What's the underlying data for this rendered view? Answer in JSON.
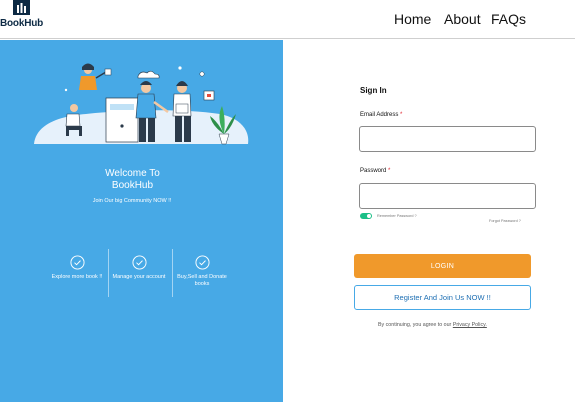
{
  "header": {
    "logo_text": "BookHub",
    "nav": {
      "home": "Home",
      "about": "About",
      "faqs": "FAQs"
    }
  },
  "left_panel": {
    "background": "#47a9e6",
    "welcome_line1": "Welcome To",
    "welcome_line2": "BookHub",
    "subtext": "Join Our big Community NOW !!",
    "features": [
      {
        "icon": "check-circle-icon",
        "label": "Explore more book !!"
      },
      {
        "icon": "check-circle-icon",
        "label": "Manage your account"
      },
      {
        "icon": "check-circle-icon",
        "label": "Buy,Sell and Donate books"
      }
    ]
  },
  "form": {
    "title": "Sign In",
    "email_label": "Email Address",
    "password_label": "Password",
    "required_marker": "*",
    "email_value": "",
    "password_value": "",
    "remember_label": "Remember Password ?",
    "remember_checked": true,
    "forgot_label": "Forgot Password ?",
    "login_button": "LOGIN",
    "register_button": "Register And Join Us NOW !!",
    "terms_prefix": "By continuing, you agree to our",
    "terms_link": "Privacy Policy."
  },
  "colors": {
    "accent_blue": "#47a9e6",
    "login_orange": "#f0992b",
    "toggle_green": "#1bbf87",
    "required_red": "#e0212b"
  }
}
